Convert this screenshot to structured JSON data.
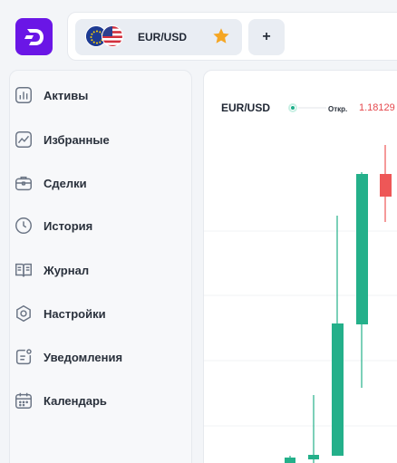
{
  "header": {
    "logo_letter": "D",
    "pair": {
      "label": "EUR/USD",
      "flags": [
        "eu-flag-icon",
        "us-flag-icon"
      ],
      "favorite": true
    },
    "add_tab_label": "+"
  },
  "sidebar": {
    "items": [
      {
        "label": "Активы",
        "icon": "assets-chart-icon"
      },
      {
        "label": "Избранные",
        "icon": "favorites-chart-icon"
      },
      {
        "label": "Сделки",
        "icon": "briefcase-icon"
      },
      {
        "label": "История",
        "icon": "clock-icon"
      },
      {
        "label": "Журнал",
        "icon": "book-icon"
      },
      {
        "label": "Настройки",
        "icon": "gear-icon"
      },
      {
        "label": "Уведомления",
        "icon": "notification-icon"
      },
      {
        "label": "Календарь",
        "icon": "calendar-icon"
      }
    ]
  },
  "chart": {
    "symbol": "EUR/USD",
    "open_label": "Откр.",
    "open_value": "1.18129"
  },
  "colors": {
    "brand": "#6a16e6",
    "bull": "#24b08a",
    "bear": "#ee5757",
    "star": "#f5a623"
  }
}
